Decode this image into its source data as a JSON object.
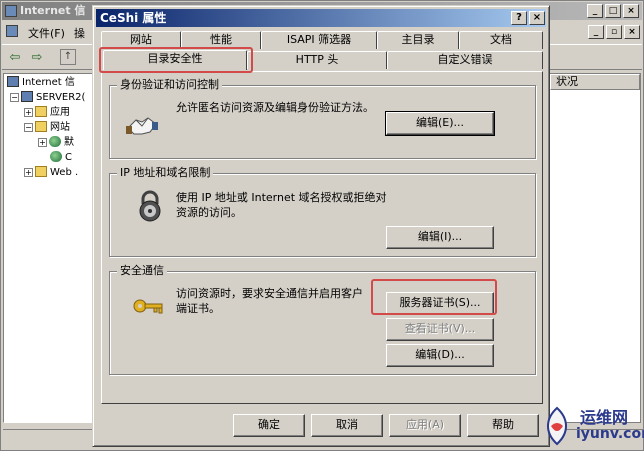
{
  "background_window": {
    "title": "Internet 信",
    "menu": [
      "文件(F)",
      "操"
    ],
    "tree": {
      "root": "Internet 信",
      "server": "SERVER2(",
      "app_pool": "应用",
      "websites": "网站",
      "site1": "默",
      "site2": "C",
      "web_ext": "Web ."
    },
    "right_column_header": "状况"
  },
  "dialog": {
    "title": "CeShi 属性",
    "help_btn": "?",
    "close_btn": "×",
    "tabs_row1": [
      "网站",
      "性能",
      "ISAPI 筛选器",
      "主目录",
      "文档"
    ],
    "tabs_row2": [
      "目录安全性",
      "HTTP 头",
      "自定义错误"
    ],
    "active_tab": "目录安全性",
    "auth": {
      "legend": "身份验证和访问控制",
      "desc": "允许匿名访问资源及编辑身份验证方法。",
      "edit_button": "编辑(E)..."
    },
    "ip": {
      "legend": "IP 地址和域名限制",
      "desc": "使用 IP 地址或 Internet 域名授权或拒绝对资源的访问。",
      "edit_button": "编辑(I)..."
    },
    "secure": {
      "legend": "安全通信",
      "desc": "访问资源时，要求安全通信并启用客户端证书。",
      "server_cert_button": "服务器证书(S)...",
      "view_cert_button": "查看证书(V)...",
      "edit_button": "编辑(D)..."
    },
    "bottom_buttons": {
      "ok": "确定",
      "cancel": "取消",
      "apply": "应用(A)",
      "help": "帮助"
    }
  },
  "watermark": {
    "line1": "运维网",
    "line2": "iyunv.com"
  },
  "colors": {
    "title_active": "#0a246a",
    "face": "#d4d0c8",
    "highlight_box": "#d24a4a"
  }
}
